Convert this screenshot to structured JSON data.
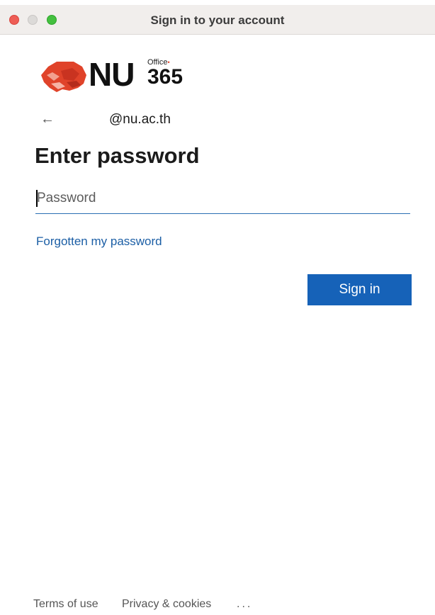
{
  "window": {
    "title": "Sign in to your account"
  },
  "brand": {
    "logo_text": "NU",
    "office_text": "Office",
    "number_text": "365",
    "accent_color": "#e0432a"
  },
  "account": {
    "back_icon": "arrow-left-icon",
    "email": "@nu.ac.th"
  },
  "main": {
    "heading": "Enter password",
    "password_placeholder": "Password",
    "password_value": "",
    "forgot_link": "Forgotten my password",
    "signin_label": "Sign in",
    "button_color": "#1662b8",
    "link_color": "#1b5ea5"
  },
  "footer": {
    "terms": "Terms of use",
    "privacy": "Privacy & cookies",
    "more": "..."
  }
}
